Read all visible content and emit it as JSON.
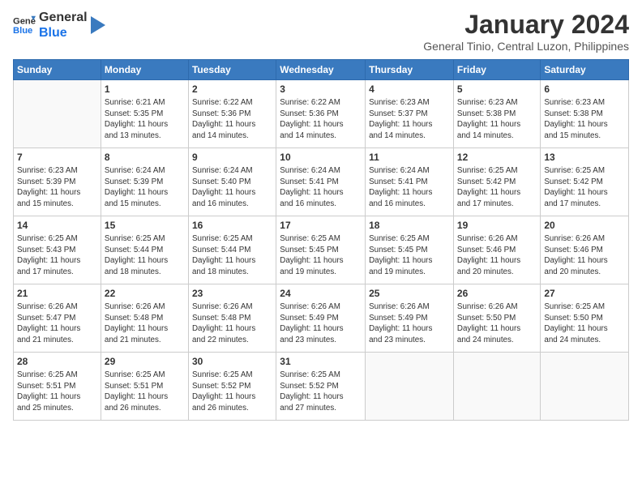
{
  "logo": {
    "line1": "General",
    "line2": "Blue"
  },
  "title": "January 2024",
  "subtitle": "General Tinio, Central Luzon, Philippines",
  "days_of_week": [
    "Sunday",
    "Monday",
    "Tuesday",
    "Wednesday",
    "Thursday",
    "Friday",
    "Saturday"
  ],
  "weeks": [
    [
      {
        "day": "",
        "info": ""
      },
      {
        "day": "1",
        "info": "Sunrise: 6:21 AM\nSunset: 5:35 PM\nDaylight: 11 hours\nand 13 minutes."
      },
      {
        "day": "2",
        "info": "Sunrise: 6:22 AM\nSunset: 5:36 PM\nDaylight: 11 hours\nand 14 minutes."
      },
      {
        "day": "3",
        "info": "Sunrise: 6:22 AM\nSunset: 5:36 PM\nDaylight: 11 hours\nand 14 minutes."
      },
      {
        "day": "4",
        "info": "Sunrise: 6:23 AM\nSunset: 5:37 PM\nDaylight: 11 hours\nand 14 minutes."
      },
      {
        "day": "5",
        "info": "Sunrise: 6:23 AM\nSunset: 5:38 PM\nDaylight: 11 hours\nand 14 minutes."
      },
      {
        "day": "6",
        "info": "Sunrise: 6:23 AM\nSunset: 5:38 PM\nDaylight: 11 hours\nand 15 minutes."
      }
    ],
    [
      {
        "day": "7",
        "info": "Sunrise: 6:23 AM\nSunset: 5:39 PM\nDaylight: 11 hours\nand 15 minutes."
      },
      {
        "day": "8",
        "info": "Sunrise: 6:24 AM\nSunset: 5:39 PM\nDaylight: 11 hours\nand 15 minutes."
      },
      {
        "day": "9",
        "info": "Sunrise: 6:24 AM\nSunset: 5:40 PM\nDaylight: 11 hours\nand 16 minutes."
      },
      {
        "day": "10",
        "info": "Sunrise: 6:24 AM\nSunset: 5:41 PM\nDaylight: 11 hours\nand 16 minutes."
      },
      {
        "day": "11",
        "info": "Sunrise: 6:24 AM\nSunset: 5:41 PM\nDaylight: 11 hours\nand 16 minutes."
      },
      {
        "day": "12",
        "info": "Sunrise: 6:25 AM\nSunset: 5:42 PM\nDaylight: 11 hours\nand 17 minutes."
      },
      {
        "day": "13",
        "info": "Sunrise: 6:25 AM\nSunset: 5:42 PM\nDaylight: 11 hours\nand 17 minutes."
      }
    ],
    [
      {
        "day": "14",
        "info": "Sunrise: 6:25 AM\nSunset: 5:43 PM\nDaylight: 11 hours\nand 17 minutes."
      },
      {
        "day": "15",
        "info": "Sunrise: 6:25 AM\nSunset: 5:44 PM\nDaylight: 11 hours\nand 18 minutes."
      },
      {
        "day": "16",
        "info": "Sunrise: 6:25 AM\nSunset: 5:44 PM\nDaylight: 11 hours\nand 18 minutes."
      },
      {
        "day": "17",
        "info": "Sunrise: 6:25 AM\nSunset: 5:45 PM\nDaylight: 11 hours\nand 19 minutes."
      },
      {
        "day": "18",
        "info": "Sunrise: 6:25 AM\nSunset: 5:45 PM\nDaylight: 11 hours\nand 19 minutes."
      },
      {
        "day": "19",
        "info": "Sunrise: 6:26 AM\nSunset: 5:46 PM\nDaylight: 11 hours\nand 20 minutes."
      },
      {
        "day": "20",
        "info": "Sunrise: 6:26 AM\nSunset: 5:46 PM\nDaylight: 11 hours\nand 20 minutes."
      }
    ],
    [
      {
        "day": "21",
        "info": "Sunrise: 6:26 AM\nSunset: 5:47 PM\nDaylight: 11 hours\nand 21 minutes."
      },
      {
        "day": "22",
        "info": "Sunrise: 6:26 AM\nSunset: 5:48 PM\nDaylight: 11 hours\nand 21 minutes."
      },
      {
        "day": "23",
        "info": "Sunrise: 6:26 AM\nSunset: 5:48 PM\nDaylight: 11 hours\nand 22 minutes."
      },
      {
        "day": "24",
        "info": "Sunrise: 6:26 AM\nSunset: 5:49 PM\nDaylight: 11 hours\nand 23 minutes."
      },
      {
        "day": "25",
        "info": "Sunrise: 6:26 AM\nSunset: 5:49 PM\nDaylight: 11 hours\nand 23 minutes."
      },
      {
        "day": "26",
        "info": "Sunrise: 6:26 AM\nSunset: 5:50 PM\nDaylight: 11 hours\nand 24 minutes."
      },
      {
        "day": "27",
        "info": "Sunrise: 6:25 AM\nSunset: 5:50 PM\nDaylight: 11 hours\nand 24 minutes."
      }
    ],
    [
      {
        "day": "28",
        "info": "Sunrise: 6:25 AM\nSunset: 5:51 PM\nDaylight: 11 hours\nand 25 minutes."
      },
      {
        "day": "29",
        "info": "Sunrise: 6:25 AM\nSunset: 5:51 PM\nDaylight: 11 hours\nand 26 minutes."
      },
      {
        "day": "30",
        "info": "Sunrise: 6:25 AM\nSunset: 5:52 PM\nDaylight: 11 hours\nand 26 minutes."
      },
      {
        "day": "31",
        "info": "Sunrise: 6:25 AM\nSunset: 5:52 PM\nDaylight: 11 hours\nand 27 minutes."
      },
      {
        "day": "",
        "info": ""
      },
      {
        "day": "",
        "info": ""
      },
      {
        "day": "",
        "info": ""
      }
    ]
  ]
}
